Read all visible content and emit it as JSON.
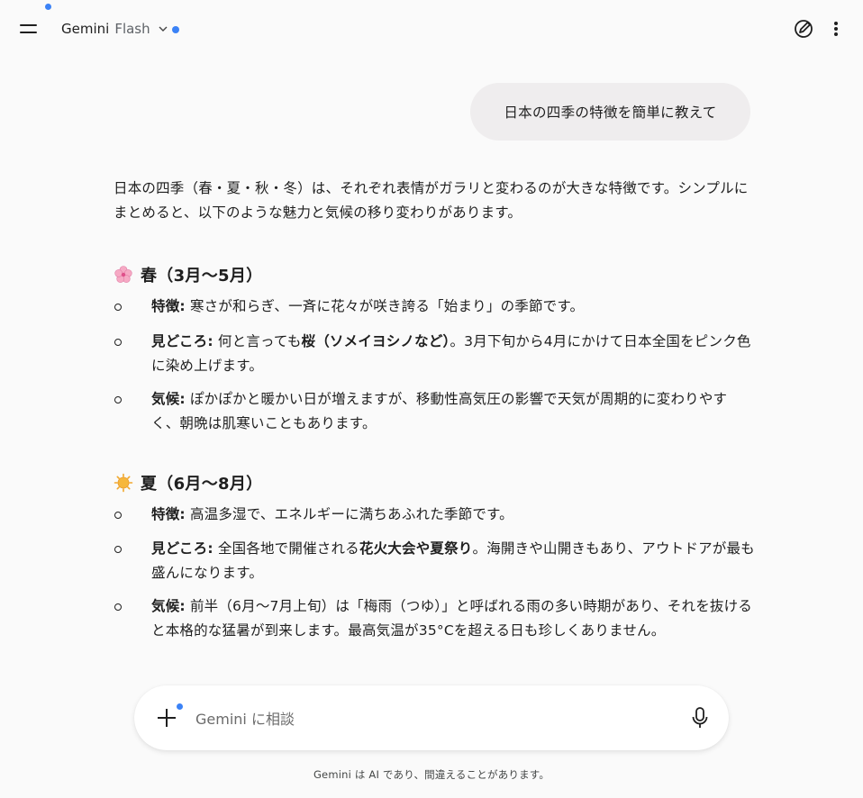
{
  "header": {
    "model_name": "Gemini",
    "model_variant": "Flash"
  },
  "conversation": {
    "user_prompt": "日本の四季の特徴を簡単に教えて",
    "intro": "日本の四季（春・夏・秋・冬）は、それぞれ表情がガラリと変わるのが大きな特徴です。シンプルにまとめると、以下のような魅力と気候の移り変わりがあります。",
    "seasons": [
      {
        "title": "春（3月〜5月）",
        "icon": "cherry-blossom-icon",
        "points": [
          {
            "key": "特徴:",
            "text": "寒さが和らぎ、一斉に花々が咲き誇る「始まり」の季節です。"
          },
          {
            "key": "見どころ:",
            "pre": "何と言っても",
            "bold": "桜（ソメイヨシノなど）",
            "post": "。3月下旬から4月にかけて日本全国をピンク色に染め上げます。"
          },
          {
            "key": "気候:",
            "text": "ぽかぽかと暖かい日が増えますが、移動性高気圧の影響で天気が周期的に変わりやすく、朝晩は肌寒いこともあります。"
          }
        ]
      },
      {
        "title": "夏（6月〜8月）",
        "icon": "sun-icon",
        "points": [
          {
            "key": "特徴:",
            "text": "高温多湿で、エネルギーに満ちあふれた季節です。"
          },
          {
            "key": "見どころ:",
            "pre": "全国各地で開催される",
            "bold": "花火大会や夏祭り",
            "post": "。海開きや山開きもあり、アウトドアが最も盛んになります。"
          },
          {
            "key": "気候:",
            "text": "前半（6月〜7月上旬）は「梅雨（つゆ）」と呼ばれる雨の多い時期があり、それを抜けると本格的な猛暑が到来します。最高気温が35°Cを超える日も珍しくありません。"
          }
        ]
      }
    ]
  },
  "input": {
    "placeholder": "Gemini に相談"
  },
  "disclaimer": "Gemini は AI であり、間違えることがあります。",
  "colors": {
    "background": "#fafafa",
    "accent_dot": "#3b82f6",
    "user_bubble": "#efedee"
  }
}
